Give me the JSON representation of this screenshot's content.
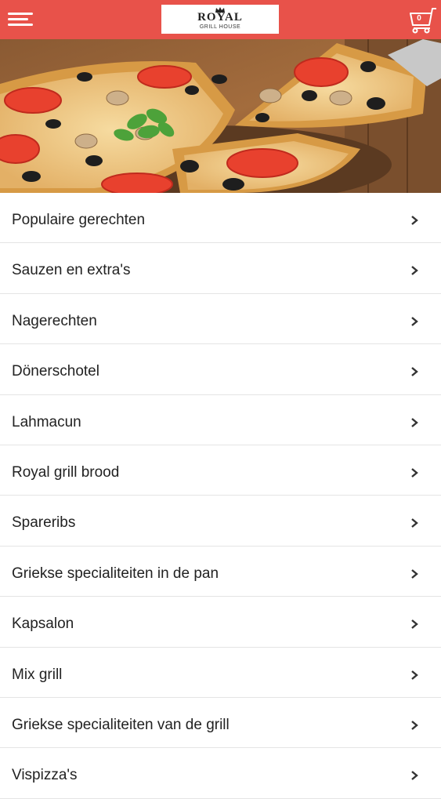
{
  "header": {
    "logo_name": "ROYAL",
    "logo_sub": "GRILL HOUSE",
    "cart_count": "0",
    "colors": {
      "bar": "#e8524a",
      "icon": "#ffffff"
    },
    "icons": {
      "menu": "hamburger-menu-icon",
      "cart": "shopping-cart-icon"
    }
  },
  "hero": {
    "image": "pizza-banner"
  },
  "menu": {
    "items": [
      {
        "label": "Populaire gerechten"
      },
      {
        "label": "Sauzen en extra's"
      },
      {
        "label": "Nagerechten"
      },
      {
        "label": "Dönerschotel"
      },
      {
        "label": "Lahmacun"
      },
      {
        "label": "Royal grill brood"
      },
      {
        "label": "Spareribs"
      },
      {
        "label": "Griekse specialiteiten in de pan"
      },
      {
        "label": "Kapsalon"
      },
      {
        "label": "Mix grill"
      },
      {
        "label": "Griekse specialiteiten van de grill"
      },
      {
        "label": "Vispizza's"
      }
    ],
    "chevron_icon": "chevron-right-icon"
  }
}
